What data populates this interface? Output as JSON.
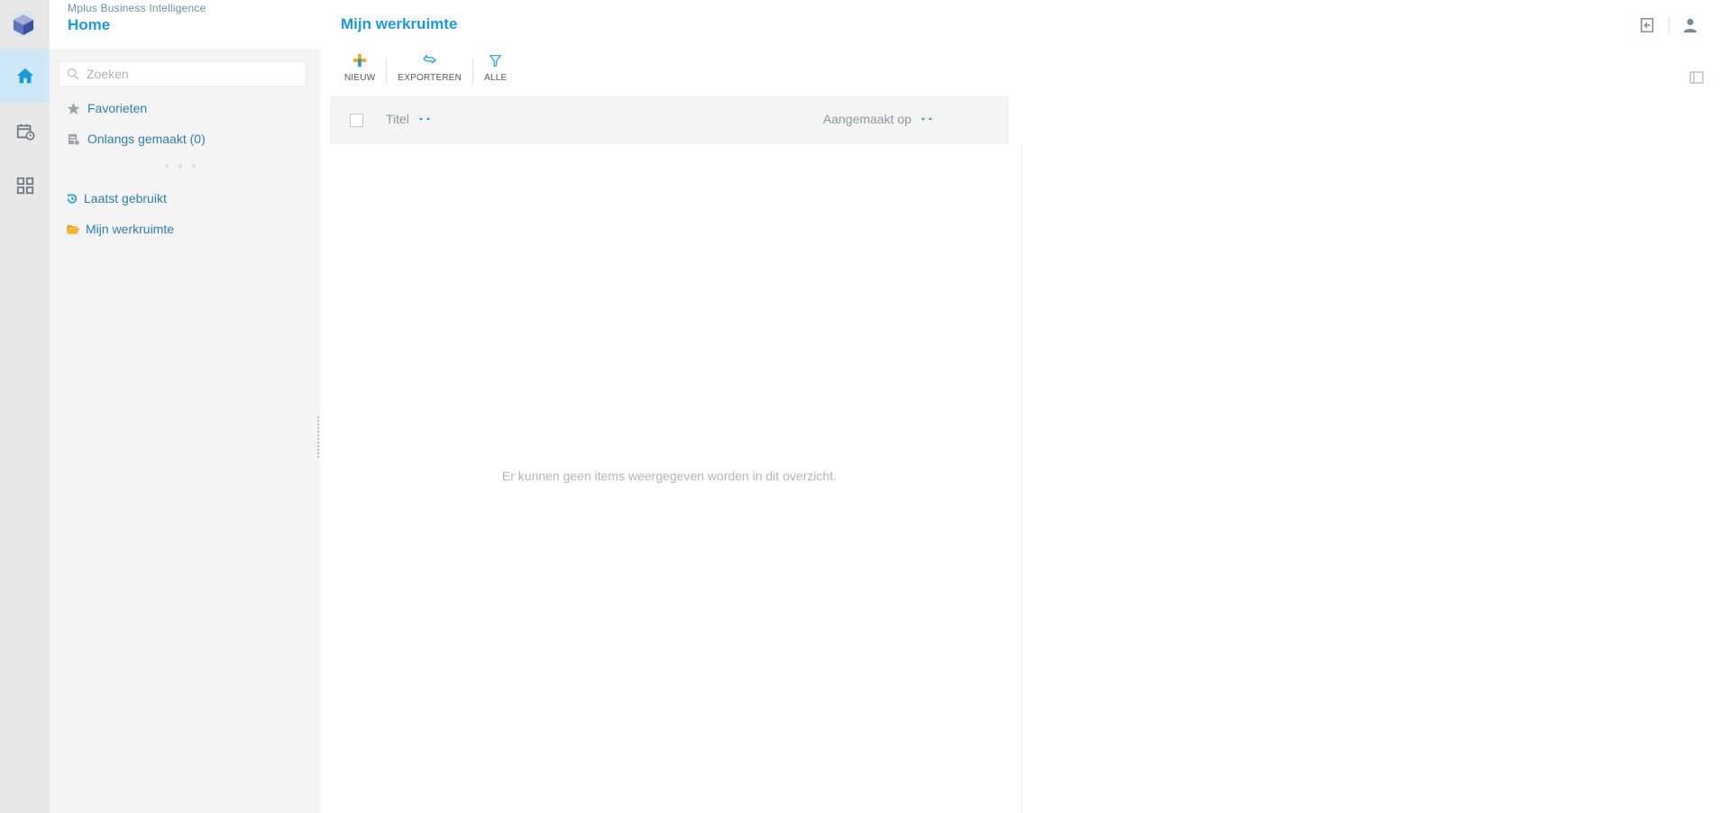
{
  "header": {
    "app_subtitle": "Mplus Business Intelligence",
    "app_title": "Home",
    "page_title": "Mijn werkruimte"
  },
  "rail": {
    "items": [
      {
        "name": "home",
        "icon": "home-icon",
        "active": true
      },
      {
        "name": "calendar",
        "icon": "calendar-clock-icon",
        "active": false
      },
      {
        "name": "apps",
        "icon": "grid-icon",
        "active": false
      }
    ]
  },
  "sidebar": {
    "search_placeholder": "Zoeken",
    "items": [
      {
        "label": "Favorieten",
        "icon": "star-icon"
      },
      {
        "label": "Onlangs gemaakt (0)",
        "icon": "recent-document-icon"
      },
      {
        "label": "Laatst gebruikt",
        "icon": "history-icon"
      },
      {
        "label": "Mijn werkruimte",
        "icon": "folder-open-icon"
      }
    ]
  },
  "toolbar": {
    "new_label": "NIEUW",
    "export_label": "EXPORTEREN",
    "filter_label": "ALLE"
  },
  "table": {
    "columns": [
      "Titel",
      "Aangemaakt op"
    ],
    "empty_message": "Er kunnen geen items weergegeven worden in dit overzicht."
  },
  "colors": {
    "accent": "#1a9bd7",
    "link": "#2f7ea8",
    "rail_bg": "#e8e8e8",
    "rail_active": "#cfe8f7",
    "panel_bg": "#f4f4f4",
    "folder": "#f0a818",
    "new_plus": "#f0a818"
  }
}
